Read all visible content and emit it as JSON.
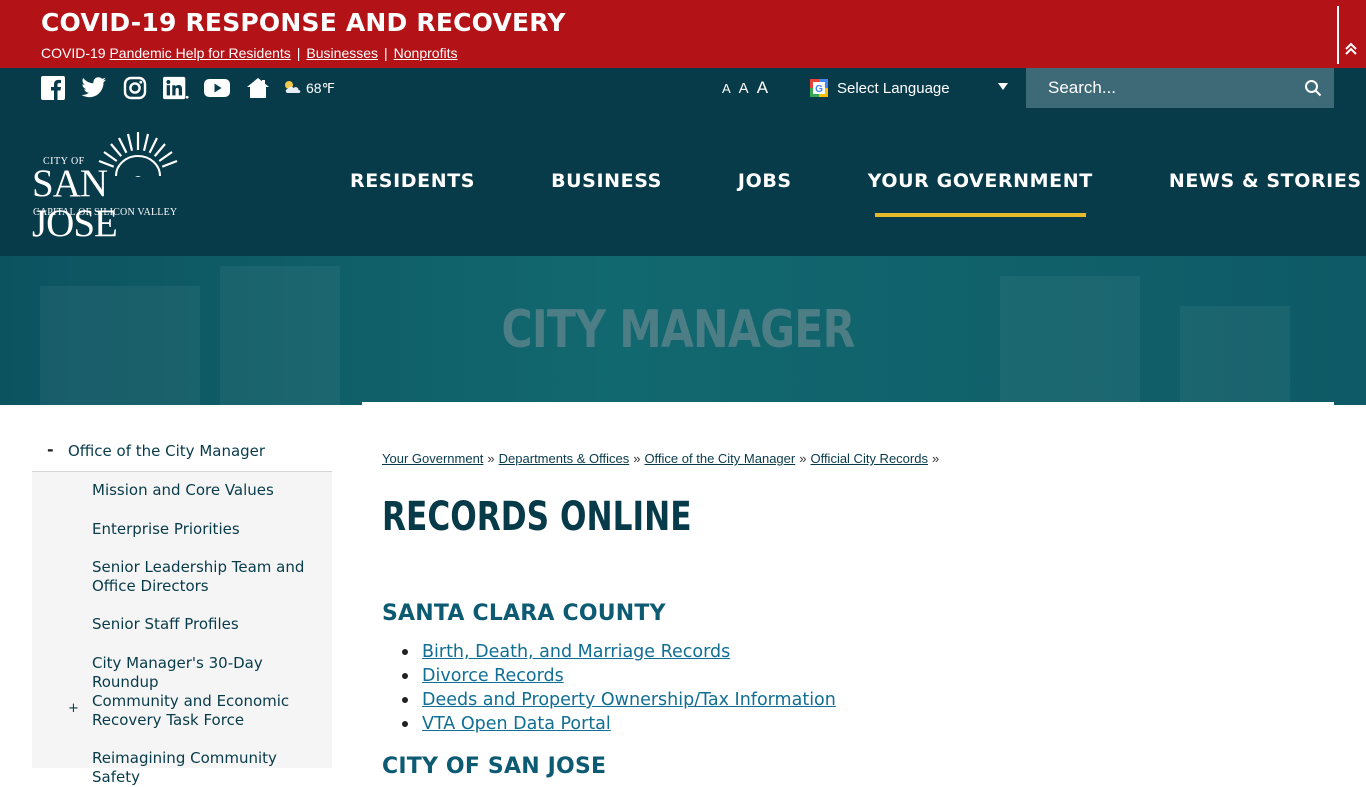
{
  "covid": {
    "title": "COVID-19 RESPONSE AND RECOVERY",
    "prefix": "COVID-19",
    "links": [
      "Pandemic Help for Residents",
      "Businesses",
      "Nonprofits"
    ],
    "separator": "|"
  },
  "utility": {
    "social_icons": [
      "facebook-icon",
      "twitter-icon",
      "instagram-icon",
      "linkedin-icon",
      "youtube-icon",
      "home-icon"
    ],
    "weather": {
      "icon": "partly-cloudy-icon",
      "temp": "68℉"
    },
    "font_sizes": [
      "A",
      "A",
      "A"
    ],
    "language": {
      "label": "Select Language",
      "icon": "google-translate-icon"
    },
    "search": {
      "placeholder": "Search..."
    }
  },
  "header": {
    "logo": {
      "city_of": "CITY OF",
      "name": "SAN JOSE",
      "tagline": "CAPITAL OF SILICON VALLEY"
    },
    "nav": [
      "RESIDENTS",
      "BUSINESS",
      "JOBS",
      "YOUR GOVERNMENT",
      "NEWS & STORIES"
    ],
    "active_nav": "YOUR GOVERNMENT"
  },
  "hero": {
    "title": "CITY MANAGER"
  },
  "sidebar": {
    "top": {
      "toggle": "-",
      "label": "Office of the City Manager"
    },
    "items": [
      {
        "label": "Mission and Core Values"
      },
      {
        "label": "Enterprise Priorities"
      },
      {
        "label": "Senior Leadership Team and Office Directors"
      },
      {
        "label": "Senior Staff Profiles"
      },
      {
        "label": "City Manager's 30-Day Roundup"
      },
      {
        "label": "Community and Economic Recovery Task Force",
        "toggle": "+"
      },
      {
        "label": "Reimagining Community Safety"
      }
    ]
  },
  "breadcrumb": {
    "items": [
      "Your Government",
      "Departments & Offices",
      "Office of the City Manager",
      "Official City Records"
    ],
    "separator": "»"
  },
  "main": {
    "title": "RECORDS ONLINE",
    "sections": [
      {
        "heading": "SANTA CLARA COUNTY",
        "links": [
          "Birth, Death, and Marriage Records",
          "Divorce Records",
          "Deeds and Property Ownership/Tax Information",
          "VTA Open Data Portal"
        ]
      },
      {
        "heading": "CITY OF SAN JOSE"
      }
    ]
  },
  "colors": {
    "banner_red": "#b31217",
    "navy": "#083b4a",
    "accent_gold": "#e8b92a",
    "link_blue": "#116e94"
  }
}
